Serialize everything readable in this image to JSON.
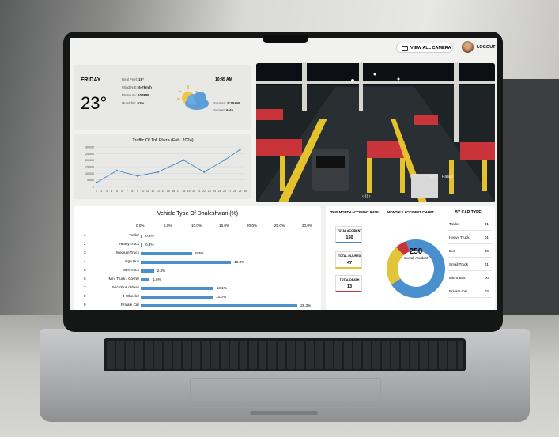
{
  "topbar": {
    "camera_button": "VIEW ALL CAMERA",
    "logout": "LOGOUT"
  },
  "weather": {
    "day": "FRIDAY",
    "temperature": "23°",
    "time": "10:45 AM",
    "details": [
      {
        "label": "Real Feel:",
        "value": "19°"
      },
      {
        "label": "Wind N-E:",
        "value": "6-7km/h"
      },
      {
        "label": "Pressure:",
        "value": "100MB"
      },
      {
        "label": "Humidity:",
        "value": "51%"
      }
    ],
    "sun": [
      {
        "label": "Sunrise:",
        "value": "5:30AM"
      },
      {
        "label": "Sunset:",
        "value": "6:45"
      }
    ]
  },
  "traffic": {
    "title": "Traffic Of Toll Plaza (Feb. 2024)"
  },
  "camera": {
    "controls": "‹ II ›",
    "label": "PTZ",
    "label2": "Panell"
  },
  "vehicle": {
    "title": "Vehicle Type Of Dhaleshwari (%)"
  },
  "accident": {
    "header1": "THIS MONTH ACCIDENT RATE",
    "header2": "MONTHLY ACCIDENT CHART",
    "header3": "BY CAR TYPE",
    "boxes": [
      {
        "label": "TOTAL ACCIDENT",
        "value": "150",
        "color": "#4a90cf"
      },
      {
        "label": "TOTAL INJURED",
        "value": "47",
        "color": "#e0c53a"
      },
      {
        "label": "TOTAL DEATH",
        "value": "13",
        "color": "#c8343a"
      }
    ],
    "donut": {
      "value": "250",
      "label": "Overall Accident"
    },
    "by_car": [
      {
        "name": "Trailer",
        "count": "01"
      },
      {
        "name": "Heavy Truck",
        "count": "01"
      },
      {
        "name": "Bus",
        "count": "06"
      },
      {
        "name": "Small Truck",
        "count": "01"
      },
      {
        "name": "Micro Bus",
        "count": "00"
      },
      {
        "name": "Private Car",
        "count": "02"
      }
    ]
  },
  "chart_data": [
    {
      "type": "line",
      "title": "Traffic Of Toll Plaza (Feb. 2024)",
      "y_ticks": [
        "30,000",
        "25,000",
        "20,000",
        "15,000",
        "10,000",
        "5,000",
        "0"
      ],
      "x": [
        1,
        2,
        3,
        4,
        5,
        6,
        7,
        8,
        9,
        10,
        11,
        12,
        13,
        14,
        15,
        16,
        17,
        18,
        19,
        20,
        21,
        22,
        23,
        24,
        25,
        26,
        27,
        28,
        29,
        30
      ],
      "points_x": [
        1,
        5,
        9,
        13,
        18,
        22,
        26,
        29
      ],
      "values": [
        3000,
        12000,
        8000,
        11000,
        20000,
        11000,
        20000,
        28000
      ],
      "ylim": [
        0,
        30000
      ]
    },
    {
      "type": "bar",
      "title": "Vehicle Type Of Dhaleshwari (%)",
      "x_ticks": [
        "0.0%",
        "5.0%",
        "10.0%",
        "15.0%",
        "20.0%",
        "25.0%",
        "30.0%"
      ],
      "xlim": [
        0,
        30
      ],
      "categories": [
        "Trailer",
        "Heavy Truck",
        "Medium Truck",
        "Large Bus",
        "Mini Truck",
        "Mini Truck / Covrer",
        "Microbus / Ideas",
        "4-Wheeler",
        "Private Car"
      ],
      "values": [
        0.3,
        0.3,
        9.3,
        16.3,
        2.4,
        1.6,
        13.1,
        13.0,
        28.3
      ],
      "labels": [
        "0.3%",
        "0.3%",
        "9.3%",
        "16.3%",
        "2.4%",
        "1.6%",
        "13.1%",
        "13.0%",
        "28.3%"
      ]
    },
    {
      "type": "pie",
      "title": "MONTHLY ACCIDENT CHART",
      "categories": [
        "TOTAL ACCIDENT",
        "TOTAL INJURED",
        "TOTAL DEATH"
      ],
      "values": [
        150,
        47,
        13
      ],
      "colors": [
        "#4a90cf",
        "#e0c53a",
        "#c8343a"
      ]
    }
  ]
}
